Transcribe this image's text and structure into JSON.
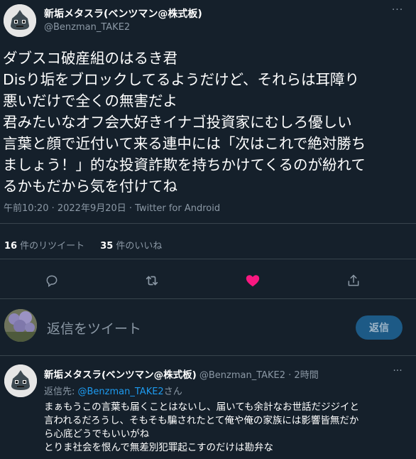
{
  "tweet": {
    "author_name": "新垢メタスラ(ベンツマン@株式板)",
    "author_handle": "@Benzman_TAKE2",
    "more_label": "···",
    "lines": [
      "ダブスコ破産組のはるき君",
      "Disり垢をブロックしてるようだけど、それらは耳障り",
      "悪いだけで全くの無害だよ",
      "君みたいなオフ会大好きイナゴ投資家にむしろ優しい",
      "言葉と顔で近付いて来る連中には「次はこれで絶対勝ち",
      "ましょう！」的な投資詐欺を持ちかけてくるのが紛れて",
      "るかもだから気を付けてね"
    ],
    "meta": "午前10:20 · 2022年9月20日 · Twitter for Android",
    "retweet_count": "16",
    "retweet_label": "件のリツイート",
    "like_count": "35",
    "like_label": "件のいいね",
    "liked": true,
    "colors": {
      "like_active": "#f91880",
      "icon": "#8b98a5",
      "link": "#1d9bf0"
    }
  },
  "actions": {
    "icons": [
      "reply-icon",
      "retweet-icon",
      "like-icon",
      "share-icon"
    ]
  },
  "reply_box": {
    "placeholder": "返信をツイート",
    "button_label": "返信"
  },
  "reply_tweet": {
    "author_name": "新垢メタスラ(ベンツマン@株式板)",
    "author_handle": "@Benzman_TAKE2",
    "time": "· 2時間",
    "more_label": "···",
    "replying_prefix": "返信先: ",
    "replying_to": "@Benzman_TAKE2",
    "replying_suffix": "さん",
    "lines": [
      "まぁもうこの言葉も届くことはないし、届いても余計なお世話だジジイと",
      "言われるだろうし、そもそも騙されたとて俺や俺の家族には影響皆無だか",
      "ら心底どうでもいいがね",
      "とりま社会を恨んで無差別犯罪起こすのだけは勘弁な"
    ]
  }
}
